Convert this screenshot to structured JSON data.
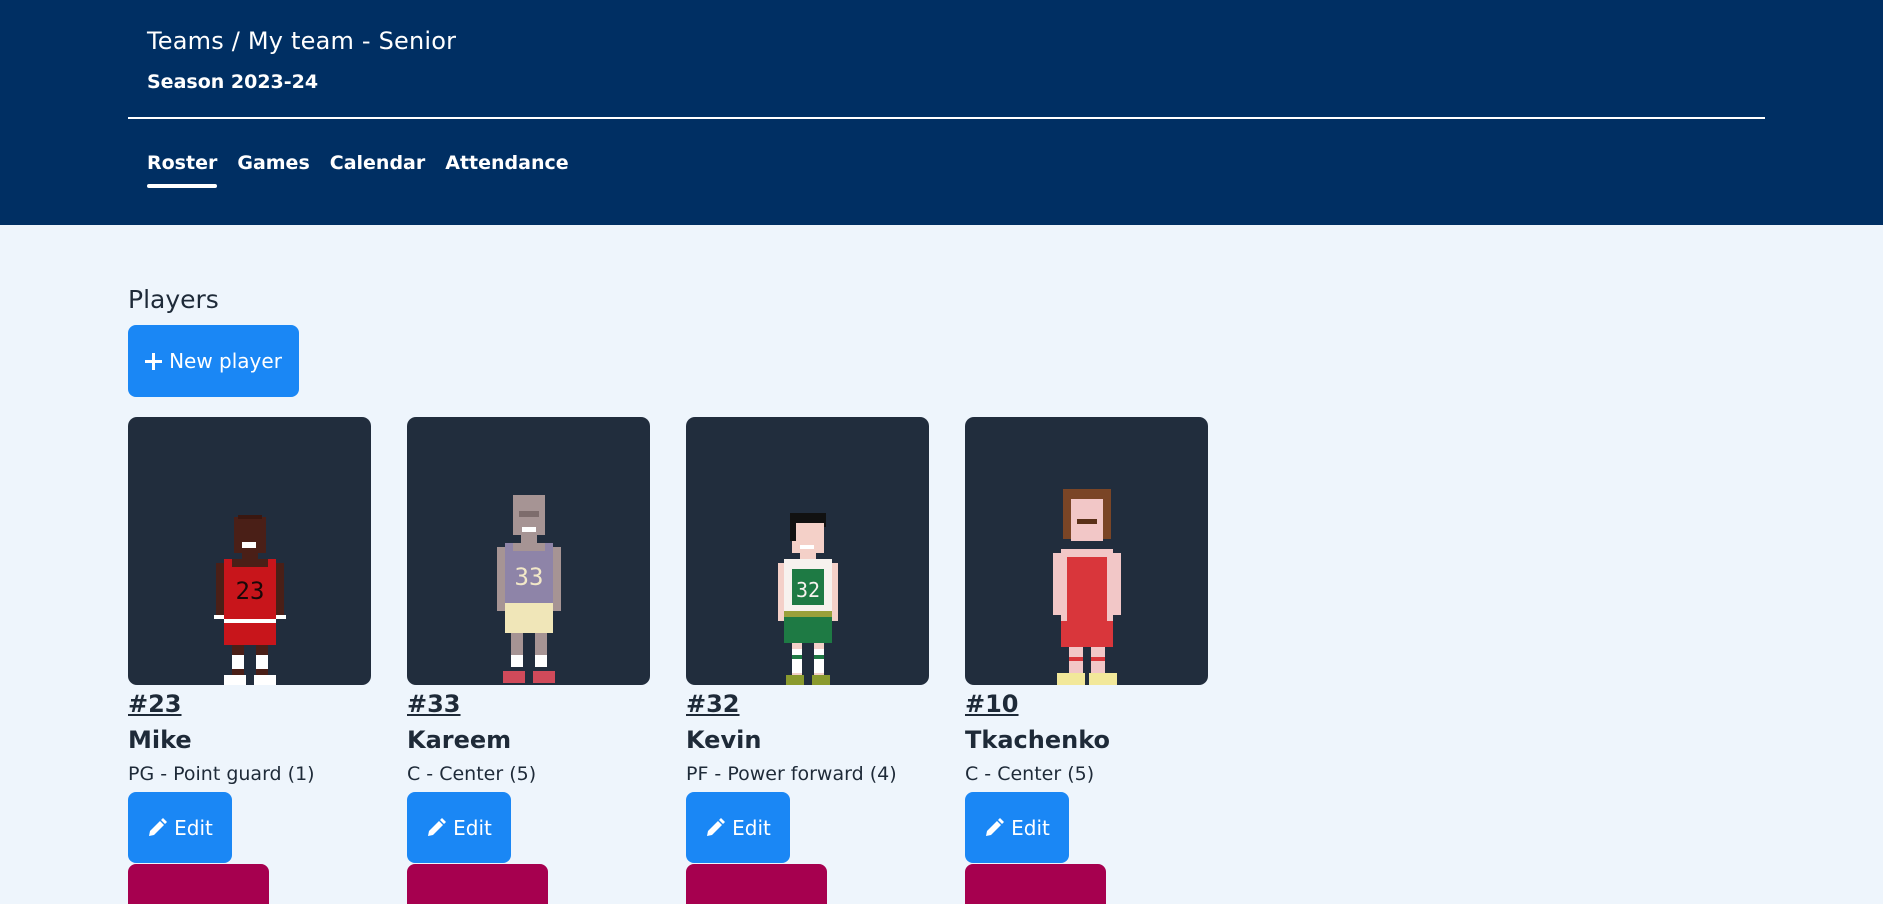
{
  "header": {
    "title": "Teams / My team - Senior",
    "season": "Season 2023-24",
    "tabs": [
      {
        "label": "Roster",
        "active": true
      },
      {
        "label": "Games",
        "active": false
      },
      {
        "label": "Calendar",
        "active": false
      },
      {
        "label": "Attendance",
        "active": false
      }
    ]
  },
  "main": {
    "section_title": "Players",
    "new_player_label": "New player",
    "new_player_icon": "plus-icon",
    "players": [
      {
        "number": "#23",
        "name": "Mike",
        "position": "PG - Point guard (1)",
        "edit_label": "Edit",
        "avatar": "pixel-player-red-23"
      },
      {
        "number": "#33",
        "name": "Kareem",
        "position": "C - Center (5)",
        "edit_label": "Edit",
        "avatar": "pixel-player-purple-33"
      },
      {
        "number": "#32",
        "name": "Kevin",
        "position": "PF - Power forward (4)",
        "edit_label": "Edit",
        "avatar": "pixel-player-green-32"
      },
      {
        "number": "#10",
        "name": "Tkachenko",
        "position": "C - Center (5)",
        "edit_label": "Edit",
        "avatar": "pixel-player-red-10"
      }
    ]
  },
  "colors": {
    "header_bg": "#002f63",
    "page_bg": "#eef5fc",
    "primary_button": "#1a87f5",
    "danger_button": "#a6004f",
    "card_bg": "#212d3d"
  }
}
